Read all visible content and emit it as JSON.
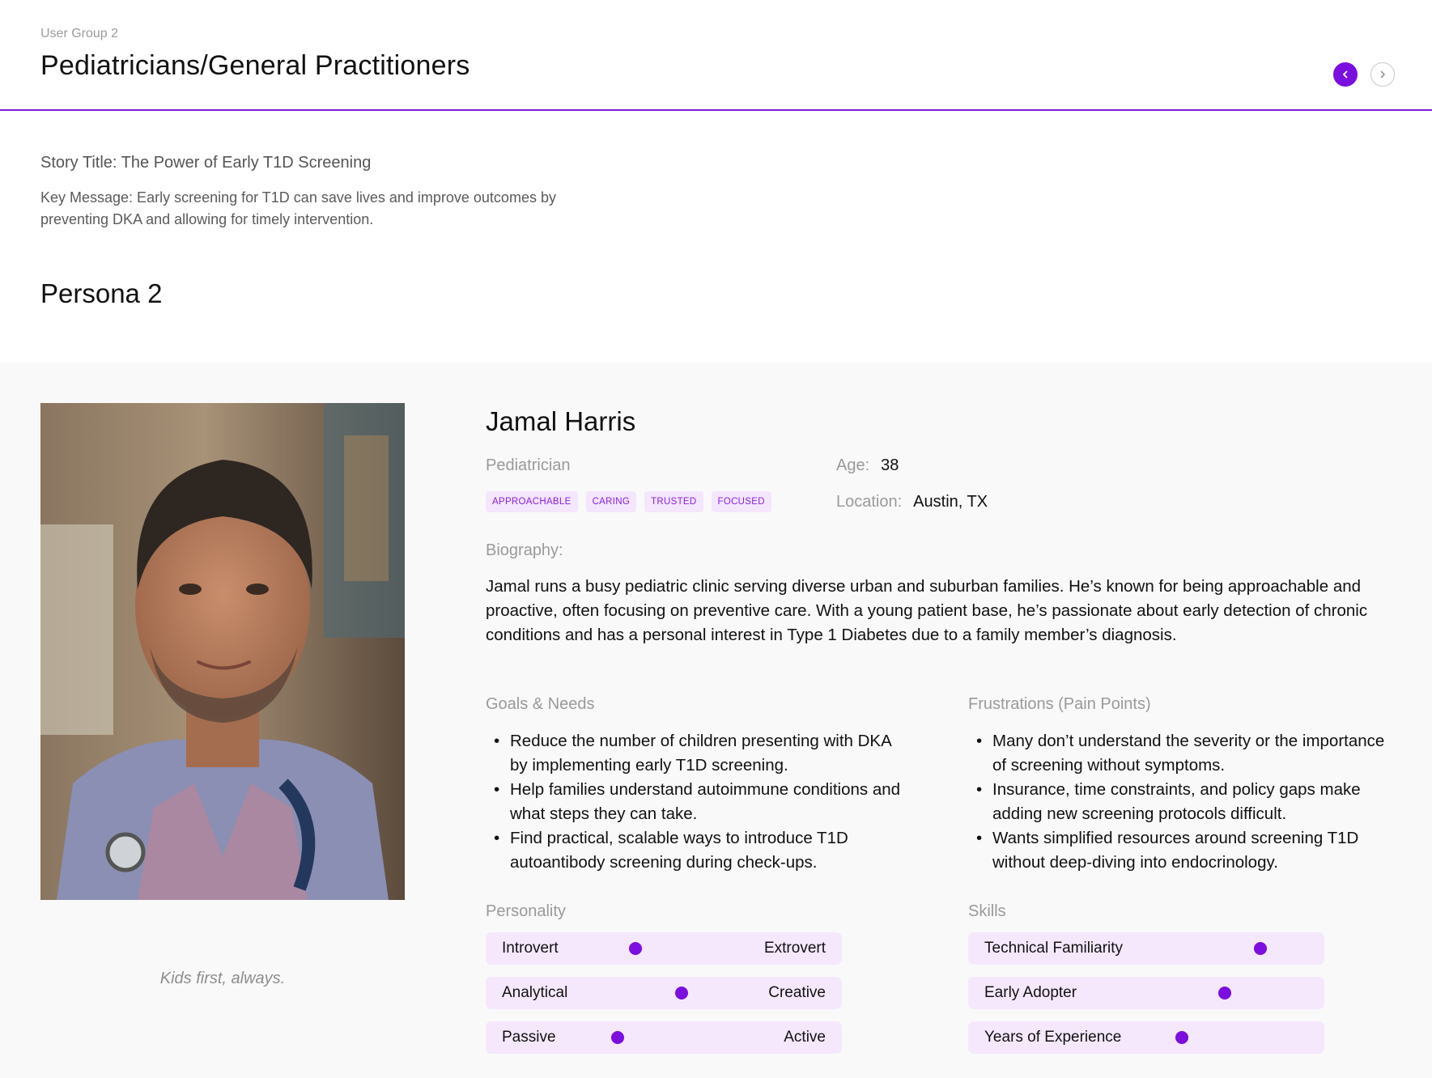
{
  "header": {
    "eyebrow": "User Group 2",
    "title": "Pediatricians/General Practitioners"
  },
  "story": {
    "title": "Story Title: The Power of Early T1D Screening",
    "key_message": "Key Message: Early screening for T1D can save lives and improve outcomes by preventing DKA and allowing for timely intervention."
  },
  "persona_heading": "Persona 2",
  "persona": {
    "name": "Jamal Harris",
    "role": "Pediatrician",
    "tags": [
      "APPROACHABLE",
      "CARING",
      "TRUSTED",
      "FOCUSED"
    ],
    "age_label": "Age:",
    "age": "38",
    "location_label": "Location:",
    "location": "Austin, TX",
    "quote": "Kids first, always.",
    "biography_label": "Biography:",
    "biography": "Jamal runs a busy pediatric clinic serving diverse urban and suburban families. He’s known for being approachable and proactive, often focusing on preventive care. With a young patient base, he’s passionate about early detection of chronic conditions and has a personal interest in Type 1 Diabetes due to a family member’s diagnosis.",
    "goals_label": "Goals & Needs",
    "goals": [
      "Reduce the number of children presenting with DKA by implementing early T1D screening.",
      "Help families understand autoimmune conditions and what steps they can take.",
      "Find practical, scalable ways to introduce T1D autoantibody screening during check-ups."
    ],
    "frustrations_label": "Frustrations (Pain Points)",
    "frustrations": [
      "Many don’t understand the severity or the importance of screening without symptoms.",
      "Insurance, time constraints, and policy gaps make adding new screening protocols difficult.",
      "Wants simplified resources around screening T1D without deep-diving into endocrinology."
    ],
    "personality_label": "Personality",
    "personality": [
      {
        "left": "Introvert",
        "right": "Extrovert",
        "value": 0.42
      },
      {
        "left": "Analytical",
        "right": "Creative",
        "value": 0.55
      },
      {
        "left": "Passive",
        "right": "Active",
        "value": 0.37
      }
    ],
    "skills_label": "Skills",
    "skills": [
      {
        "label": "Technical Familiarity",
        "value": 0.82
      },
      {
        "label": "Early Adopter",
        "value": 0.72
      },
      {
        "label": "Years of Experience",
        "value": 0.6
      }
    ]
  },
  "colors": {
    "accent": "#7a0fe0",
    "tag_bg": "#f4e6fd",
    "slider_bg": "#f5e8fd"
  },
  "icons": {
    "prev": "chevron-left-icon",
    "next": "chevron-right-icon"
  }
}
